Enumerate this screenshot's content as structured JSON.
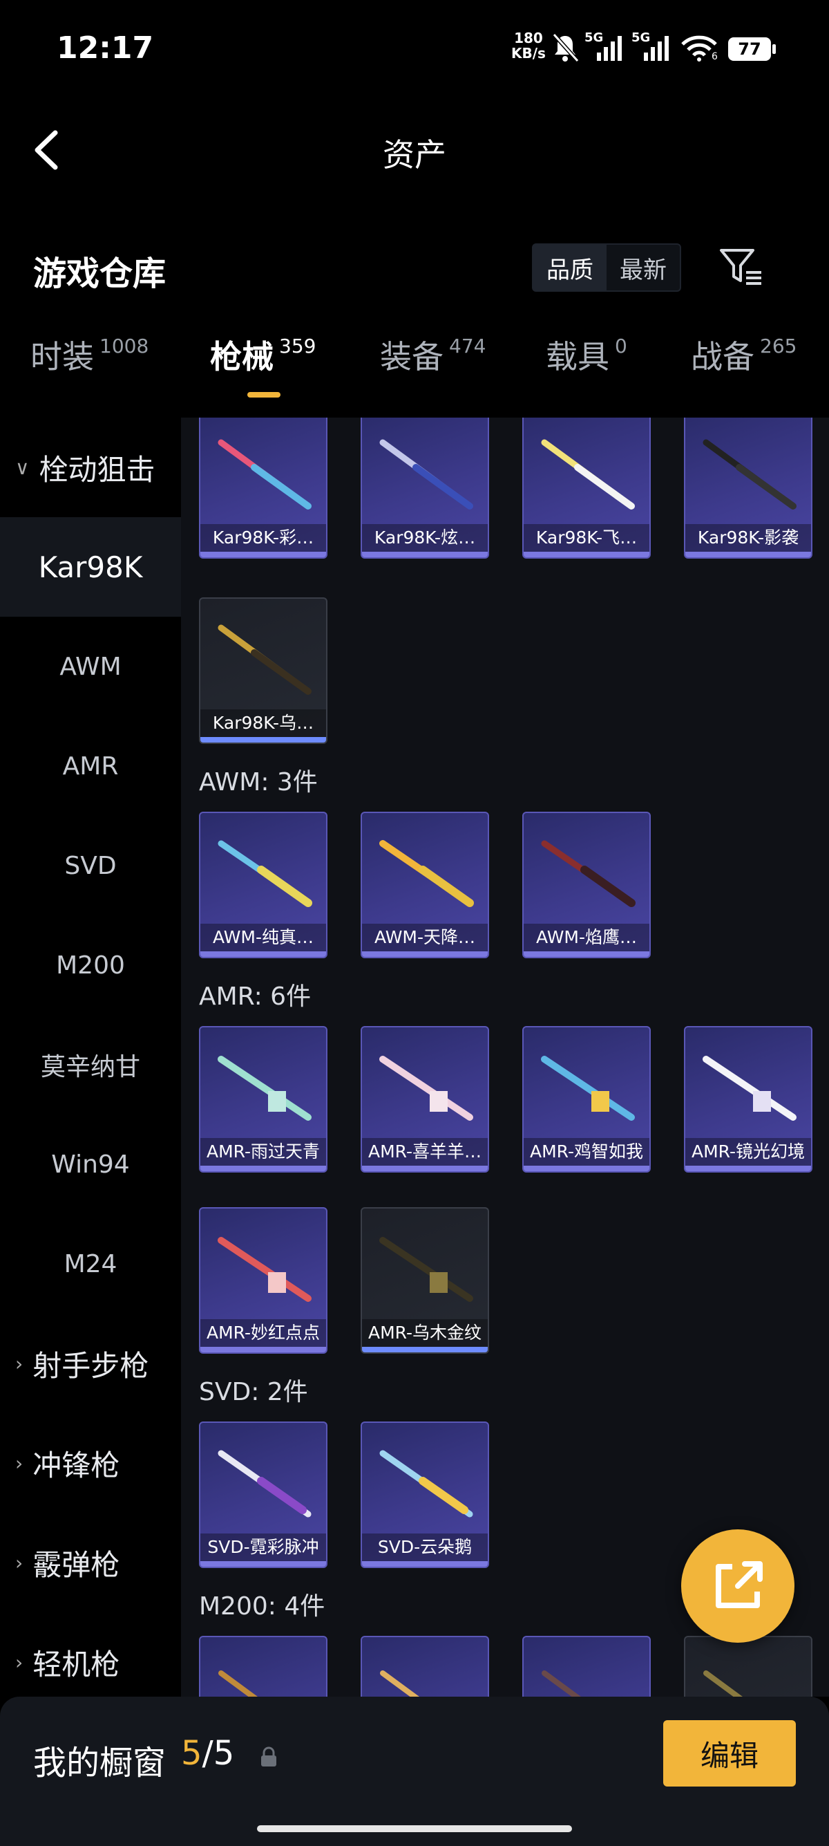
{
  "status_bar": {
    "time": "12:17",
    "net_speed": "180",
    "net_unit": "KB/s",
    "sig1": "5G",
    "sig2": "5G",
    "battery": "77",
    "wifi_sub": "6"
  },
  "nav": {
    "title": "资产"
  },
  "header": {
    "title": "游戏仓库",
    "sort_options": [
      "品质",
      "最新"
    ],
    "active_sort": "品质"
  },
  "tabs": [
    {
      "label": "时装",
      "count": "1008"
    },
    {
      "label": "枪械",
      "count": "359"
    },
    {
      "label": "装备",
      "count": "474"
    },
    {
      "label": "载具",
      "count": "0"
    },
    {
      "label": "战备",
      "count": "265"
    }
  ],
  "active_tab": "枪械",
  "sidebar": {
    "group": "栓动狙击",
    "items": [
      "Kar98K",
      "AWM",
      "AMR",
      "SVD",
      "M200",
      "莫辛纳甘",
      "Win94",
      "M24"
    ],
    "selected": "Kar98K",
    "collapsed": [
      "射手步枪",
      "冲锋枪",
      "霰弹枪",
      "轻机枪"
    ]
  },
  "sections": [
    {
      "label": "",
      "items": [
        "Kar98K-彩…",
        "Kar98K-炫…",
        "Kar98K-飞…",
        "Kar98K-影袭",
        "Kar98K-乌…"
      ]
    },
    {
      "label": "AWM: 3件",
      "items": [
        "AWM-纯真…",
        "AWM-天降…",
        "AWM-焰鹰…"
      ]
    },
    {
      "label": "AMR: 6件",
      "items": [
        "AMR-雨过天青",
        "AMR-喜羊羊…",
        "AMR-鸡智如我",
        "AMR-镜光幻境",
        "AMR-妙红点点",
        "AMR-乌木金纹"
      ]
    },
    {
      "label": "SVD: 2件",
      "items": [
        "SVD-霓彩脉冲",
        "SVD-云朵鹅"
      ]
    },
    {
      "label": "M200: 4件",
      "items": []
    }
  ],
  "showcase": {
    "label": "我的橱窗",
    "count_current": "5",
    "count_sep": "/",
    "count_total": "5",
    "edit_label": "编辑"
  },
  "colors": {
    "accent": "#f2b53a",
    "card_purple": "#3d3a8c",
    "background": "#000000"
  }
}
